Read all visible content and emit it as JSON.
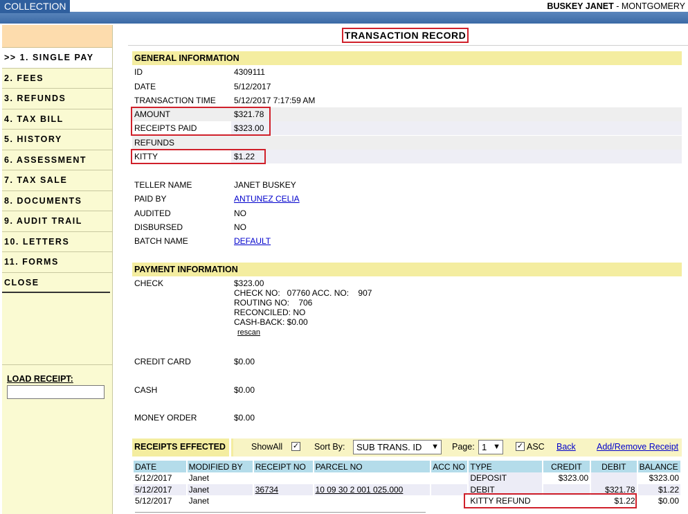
{
  "header": {
    "app_tab": "COLLECTION",
    "user_name": "BUSKEY JANET",
    "user_location": " - MONTGOMERY"
  },
  "sidebar": {
    "items": [
      {
        "label": ">> 1. SINGLE PAY"
      },
      {
        "label": "2. FEES"
      },
      {
        "label": "3. REFUNDS"
      },
      {
        "label": "4. TAX BILL"
      },
      {
        "label": "5. HISTORY"
      },
      {
        "label": "6. ASSESSMENT"
      },
      {
        "label": "7. TAX SALE"
      },
      {
        "label": "8. DOCUMENTS"
      },
      {
        "label": "9. AUDIT TRAIL"
      },
      {
        "label": "10. LETTERS"
      },
      {
        "label": "11. FORMS"
      },
      {
        "label": "CLOSE"
      }
    ],
    "load_receipt_label": "LOAD RECEIPT:",
    "load_receipt_value": ""
  },
  "page_title": "TRANSACTION RECORD",
  "general": {
    "heading": "GENERAL INFORMATION",
    "rows": [
      {
        "label": "ID",
        "value": "4309111"
      },
      {
        "label": "DATE",
        "value": "5/12/2017"
      },
      {
        "label": "TRANSACTION TIME",
        "value": "5/12/2017 7:17:59 AM"
      },
      {
        "label": "AMOUNT",
        "value": "$321.78"
      },
      {
        "label": "RECEIPTS PAID",
        "value": "$323.00"
      },
      {
        "label": "REFUNDS",
        "value": ""
      },
      {
        "label": "KITTY",
        "value": "$1.22"
      }
    ],
    "teller_rows": [
      {
        "label": "TELLER NAME",
        "value": "JANET BUSKEY"
      },
      {
        "label": "PAID BY",
        "value": "ANTUNEZ CELIA"
      },
      {
        "label": "AUDITED",
        "value": "NO"
      },
      {
        "label": "DISBURSED",
        "value": "NO"
      },
      {
        "label": "BATCH NAME",
        "value": "DEFAULT"
      }
    ]
  },
  "payment": {
    "heading": "PAYMENT INFORMATION",
    "check_label": "CHECK",
    "check_lines": [
      "$323.00",
      "CHECK NO:   07760 ACC. NO:    907",
      "ROUTING NO:    706",
      "RECONCILED: NO",
      "CASH-BACK: $0.00"
    ],
    "rescan": "rescan",
    "other": [
      {
        "label": "CREDIT CARD",
        "value": "$0.00"
      },
      {
        "label": "CASH",
        "value": "$0.00"
      },
      {
        "label": "MONEY ORDER",
        "value": "$0.00"
      }
    ]
  },
  "receipts": {
    "heading": "RECEIPTS EFFECTED",
    "show_all_label": "ShowAll",
    "show_all_checked": true,
    "sort_by_label": "Sort By:",
    "sort_by_value": "SUB TRANS. ID",
    "page_label": "Page:",
    "page_value": "1",
    "asc_label": "ASC",
    "asc_checked": true,
    "back_link": "Back",
    "add_remove_link": "Add/Remove Receipt",
    "columns": [
      "DATE",
      "MODIFIED BY",
      "RECEIPT NO",
      "PARCEL NO",
      "ACC NO",
      "TYPE",
      "CREDIT",
      "DEBIT",
      "BALANCE"
    ],
    "rows": [
      [
        "5/12/2017",
        "Janet",
        "",
        "",
        "",
        "DEPOSIT",
        "$323.00",
        "",
        "$323.00"
      ],
      [
        "5/12/2017",
        "Janet",
        "36734",
        "10 09 30 2 001 025.000",
        "",
        "DEBIT",
        "",
        "$321.78",
        "$1.22"
      ],
      [
        "5/12/2017",
        "Janet",
        "",
        "",
        "",
        "KITTY REFUND",
        "",
        "$1.22",
        "$0.00"
      ]
    ]
  },
  "colors": {
    "header_blue": "#3b6aa6",
    "section_yellow": "#f4eda0",
    "sidebar_yellow": "#fafad2",
    "highlight_red": "#d0202a",
    "table_header": "#b4dcea",
    "link_blue": "#0000cc"
  }
}
